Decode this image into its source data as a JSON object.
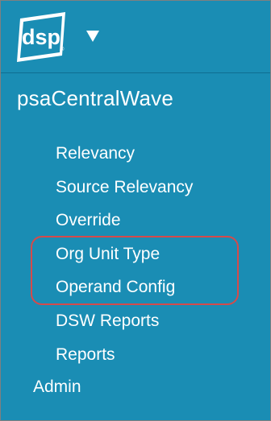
{
  "header": {
    "logo_text": "dsp",
    "logo_mark": "®",
    "menu_icon": "caret-down-icon"
  },
  "app": {
    "title": "psaCentralWave"
  },
  "nav": {
    "items": [
      {
        "label": "Relevancy"
      },
      {
        "label": "Source Relevancy"
      },
      {
        "label": "Override"
      },
      {
        "label": "Org Unit Type"
      },
      {
        "label": "Operand Config"
      },
      {
        "label": "DSW Reports"
      },
      {
        "label": "Reports"
      }
    ],
    "admin_label": "Admin"
  },
  "colors": {
    "panel_bg": "#1a8db4",
    "highlight_border": "#d64a4a",
    "text": "#ffffff"
  }
}
